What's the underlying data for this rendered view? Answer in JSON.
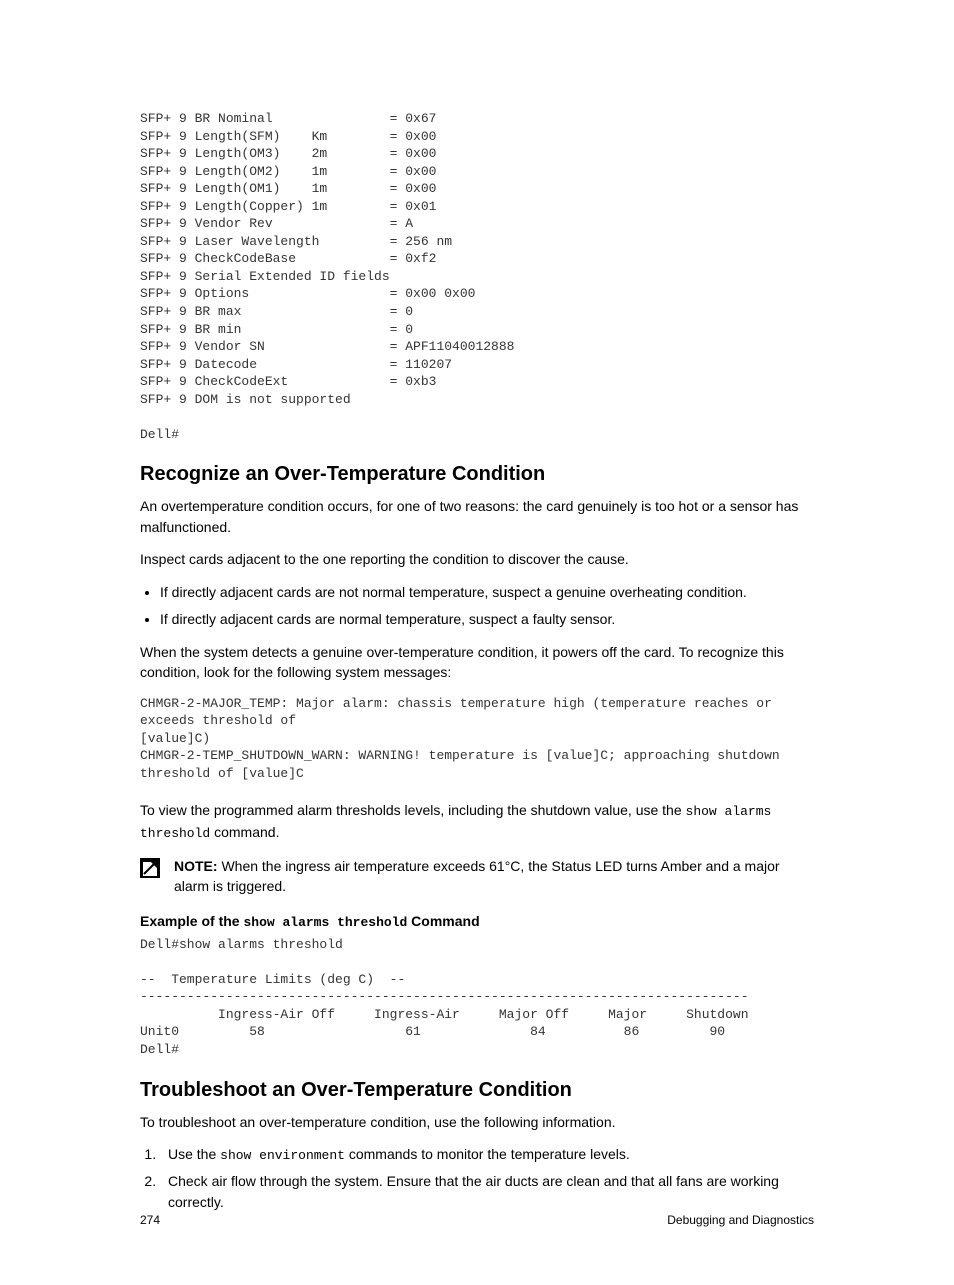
{
  "code_block_top": "SFP+ 9 BR Nominal               = 0x67\nSFP+ 9 Length(SFM)    Km        = 0x00\nSFP+ 9 Length(OM3)    2m        = 0x00\nSFP+ 9 Length(OM2)    1m        = 0x00\nSFP+ 9 Length(OM1)    1m        = 0x00\nSFP+ 9 Length(Copper) 1m        = 0x01\nSFP+ 9 Vendor Rev               = A\nSFP+ 9 Laser Wavelength         = 256 nm\nSFP+ 9 CheckCodeBase            = 0xf2\nSFP+ 9 Serial Extended ID fields\nSFP+ 9 Options                  = 0x00 0x00\nSFP+ 9 BR max                   = 0\nSFP+ 9 BR min                   = 0\nSFP+ 9 Vendor SN                = APF11040012888\nSFP+ 9 Datecode                 = 110207\nSFP+ 9 CheckCodeExt             = 0xb3\nSFP+ 9 DOM is not supported\n\nDell#",
  "section1": {
    "heading": "Recognize an Over-Temperature Condition",
    "para1": "An overtemperature condition occurs, for one of two reasons: the card genuinely is too hot or a sensor has malfunctioned.",
    "para2": "Inspect cards adjacent to the one reporting the condition to discover the cause.",
    "bullets": [
      "If directly adjacent cards are not normal temperature, suspect a genuine overheating condition.",
      "If directly adjacent cards are normal temperature, suspect a faulty sensor."
    ],
    "para3": "When the system detects a genuine over-temperature condition, it powers off the card. To recognize this condition, look for the following system messages:",
    "code_msgs": "CHMGR-2-MAJOR_TEMP: Major alarm: chassis temperature high (temperature reaches or exceeds threshold of\n[value]C)\nCHMGR-2-TEMP_SHUTDOWN_WARN: WARNING! temperature is [value]C; approaching shutdown threshold of [value]C",
    "para4_prefix": "To view the programmed alarm thresholds levels, including the shutdown value, use the ",
    "para4_code": "show alarms threshold",
    "para4_suffix": " command.",
    "note_label": "NOTE:",
    "note_text": " When the ingress air temperature exceeds 61°C, the Status LED turns Amber and a major alarm is triggered.",
    "example_label_prefix": "Example of the ",
    "example_label_code": "show alarms threshold",
    "example_label_suffix": " Command",
    "code_example": "Dell#show alarms threshold\n\n--  Temperature Limits (deg C)  --\n------------------------------------------------------------------------------\n          Ingress-Air Off     Ingress-Air     Major Off     Major     Shutdown\nUnit0         58                  61              84          86         90\nDell#"
  },
  "section2": {
    "heading": "Troubleshoot an Over-Temperature Condition",
    "para1": "To troubleshoot an over-temperature condition, use the following information.",
    "step1_prefix": "Use the ",
    "step1_code": "show environment",
    "step1_suffix": " commands to monitor the temperature levels.",
    "step2": "Check air flow through the system. Ensure that the air ducts are clean and that all fans are working correctly."
  },
  "footer": {
    "page_number": "274",
    "section_title": "Debugging and Diagnostics"
  }
}
